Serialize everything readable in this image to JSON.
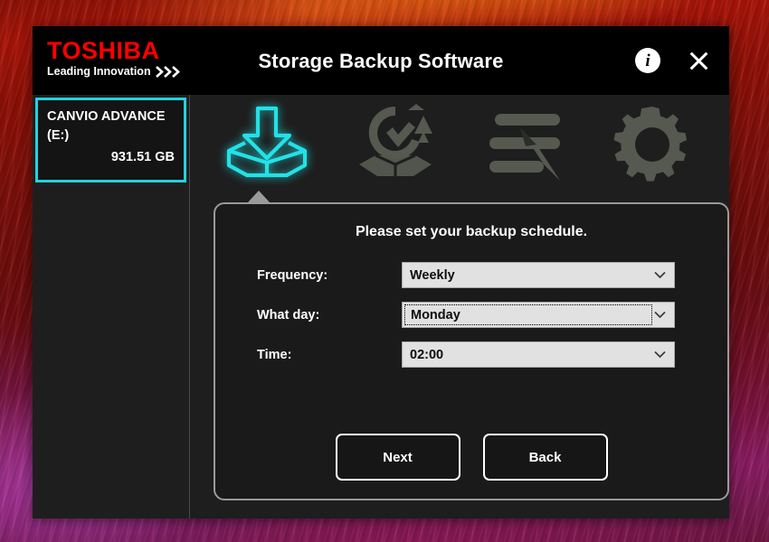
{
  "window": {
    "brand_name": "TOSHIBA",
    "brand_tagline": "Leading Innovation",
    "title": "Storage Backup Software",
    "info_label": "i"
  },
  "sidebar": {
    "device": {
      "name": "CANVIO ADVANCE",
      "drive_letter": "(E:)",
      "capacity": "931.51 GB"
    }
  },
  "toolbar": {
    "items": [
      {
        "icon": "backup-download-icon",
        "name": "backup",
        "active": true
      },
      {
        "icon": "restore-refresh-icon",
        "name": "restore",
        "active": false
      },
      {
        "icon": "log-pencil-icon",
        "name": "log",
        "active": false
      },
      {
        "icon": "gear-icon",
        "name": "settings",
        "active": false
      }
    ]
  },
  "panel": {
    "heading": "Please set your backup schedule.",
    "fields": [
      {
        "label": "Frequency:",
        "value": "Weekly",
        "focused": false
      },
      {
        "label": "What day:",
        "value": "Monday",
        "focused": true
      },
      {
        "label": "Time:",
        "value": "02:00",
        "focused": false
      }
    ],
    "buttons": {
      "next": "Next",
      "back": "Back"
    }
  },
  "colors": {
    "brand_red": "#ff0000",
    "accent_cyan": "#22d3e0",
    "window_bg": "#1e1e1e",
    "titlebar_bg": "#000000",
    "select_bg": "#e1e1e1",
    "icon_inactive": "#55594f"
  }
}
